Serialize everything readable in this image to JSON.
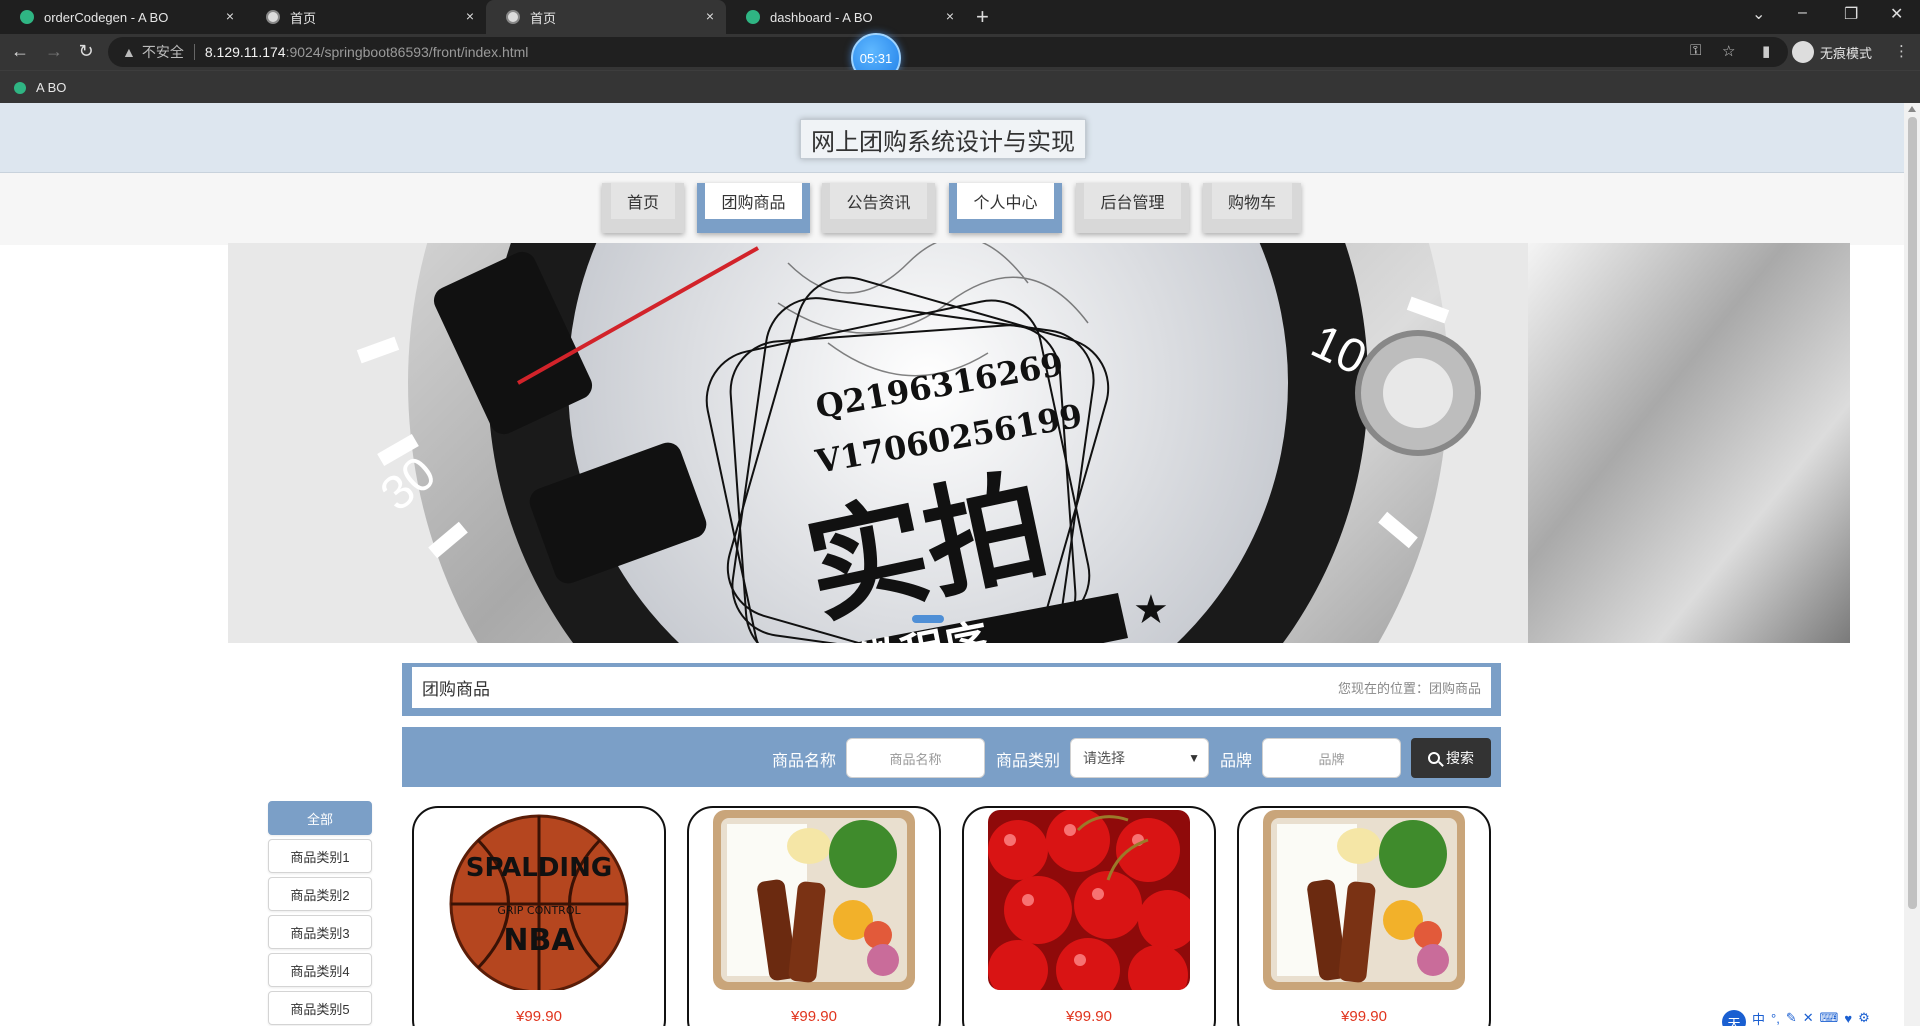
{
  "browser": {
    "tabs": [
      {
        "title": "orderCodegen - A BO",
        "favicon": "green-leaf-icon",
        "active": false
      },
      {
        "title": "首页",
        "favicon": "globe-icon",
        "active": false
      },
      {
        "title": "首页",
        "favicon": "globe-icon",
        "active": true
      },
      {
        "title": "dashboard - A BO",
        "favicon": "green-leaf-icon",
        "active": false
      }
    ],
    "close_glyph": "×",
    "new_tab_glyph": "+",
    "url_insecure_label": "不安全",
    "url_host": "8.129.11.174",
    "url_path": ":9024/springboot86593/front/index.html",
    "timer": "05:31",
    "incognito_label": "无痕模式",
    "bookmark": "A BO"
  },
  "site": {
    "title": "网上团购系统设计与实现",
    "menu": [
      {
        "label": "首页",
        "style": "gray"
      },
      {
        "label": "团购商品",
        "style": "blue"
      },
      {
        "label": "公告资讯",
        "style": "gray"
      },
      {
        "label": "个人中心",
        "style": "blue"
      },
      {
        "label": "后台管理",
        "style": "gray"
      },
      {
        "label": "购物车",
        "style": "gray"
      }
    ],
    "watermark": {
      "line1": "Q2196316269",
      "line2": "V17060256199",
      "big": "实拍",
      "ribbon": "全微程序"
    },
    "banner_dial_numbers": [
      "10",
      "30"
    ],
    "breadcrumb": {
      "title": "团购商品",
      "location_label": "您现在的位置：",
      "location_value": "团购商品"
    },
    "search": {
      "name_label": "商品名称",
      "name_placeholder": "商品名称",
      "category_label": "商品类别",
      "category_value": "请选择",
      "brand_label": "品牌",
      "brand_placeholder": "品牌",
      "button_label": "搜索"
    },
    "categories": [
      "全部",
      "商品类别1",
      "商品类别2",
      "商品类别3",
      "商品类别4",
      "商品类别5"
    ],
    "products": [
      {
        "image": "basketball",
        "price": "¥99.90"
      },
      {
        "image": "bento-meal",
        "price": "¥99.90"
      },
      {
        "image": "cherries",
        "price": "¥99.90"
      },
      {
        "image": "bento-meal",
        "price": "¥99.90"
      }
    ],
    "product_image_text": {
      "brand": "SPALDING",
      "sub": "GRIP CONTROL",
      "league": "NBA"
    },
    "colors": {
      "accent": "#7b9fc7",
      "price": "#e0341d",
      "header_bg": "#dde6ef"
    }
  },
  "ime": {
    "logo": "天",
    "mode": "中"
  }
}
